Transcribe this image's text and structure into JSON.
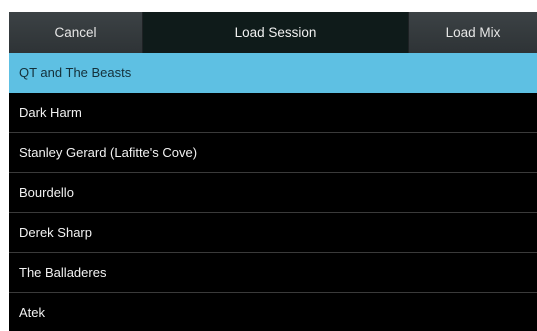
{
  "header": {
    "cancel_label": "Cancel",
    "title": "Load Session",
    "load_mix_label": "Load Mix"
  },
  "sessions": [
    {
      "label": "QT and The Beasts",
      "selected": true
    },
    {
      "label": "Dark Harm"
    },
    {
      "label": "Stanley Gerard (Lafitte's Cove)"
    },
    {
      "label": "Bourdello"
    },
    {
      "label": "Derek Sharp"
    },
    {
      "label": "The Balladeres"
    },
    {
      "label": "Atek"
    }
  ],
  "colors": {
    "selected_row": "#5ec0e3",
    "background": "#000000",
    "header_button": "#363b3e"
  }
}
